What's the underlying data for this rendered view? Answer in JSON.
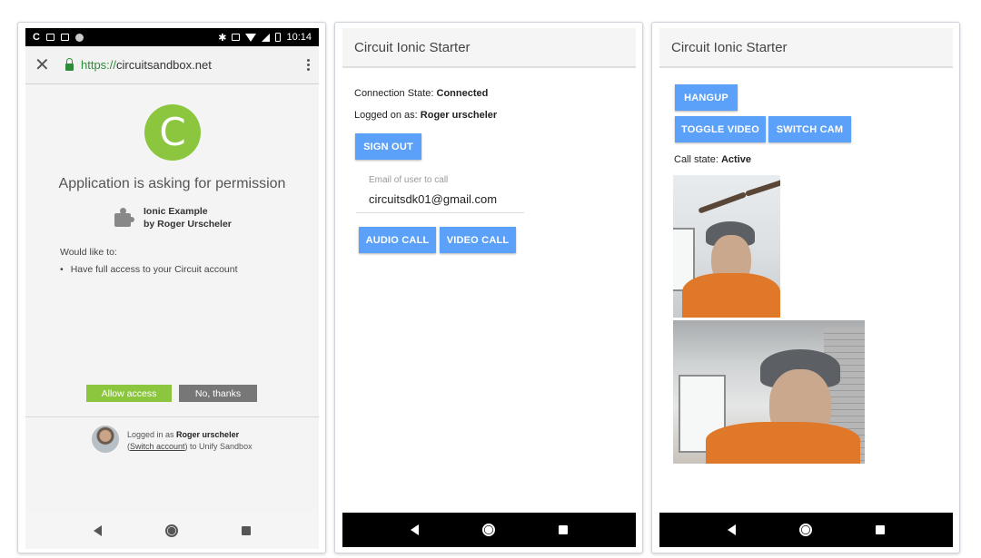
{
  "screen1": {
    "status": {
      "left_glyph": "C",
      "time": "10:14"
    },
    "browser": {
      "close": "✕",
      "url_scheme": "https://",
      "url_host": "circuitsandbox.net"
    },
    "permission": {
      "badge_letter": "C",
      "title": "Application is asking for permission",
      "app_name": "Ionic Example",
      "app_author": "by Roger Urscheler",
      "would_like": "Would like to:",
      "bullet": "Have full access to your Circuit account",
      "allow": "Allow access",
      "deny": "No, thanks",
      "logged_in_prefix": "Logged in as ",
      "logged_in_user": "Roger urscheler",
      "switch_link": "Switch account",
      "switch_suffix": ") to Unify Sandbox",
      "switch_prefix": "("
    },
    "nav": {
      "back": "back-icon",
      "home": "home-icon",
      "recents": "recents-icon"
    }
  },
  "screen2": {
    "header_title": "Circuit Ionic Starter",
    "connection_label": "Connection State: ",
    "connection_value": "Connected",
    "logged_label": "Logged on as: ",
    "logged_value": "Roger urscheler",
    "sign_out": "SIGN OUT",
    "email_label": "Email of user to call",
    "email_value": "circuitsdk01@gmail.com",
    "audio_call": "AUDIO CALL",
    "video_call": "VIDEO CALL"
  },
  "screen3": {
    "header_title": "Circuit Ionic Starter",
    "hangup": "HANGUP",
    "toggle_video": "TOGGLE VIDEO",
    "switch_cam": "SWITCH CAM",
    "call_state_label": "Call state: ",
    "call_state_value": "Active"
  },
  "colors": {
    "accent_green": "#8cc63f",
    "button_blue": "#5ba0f9",
    "deny_gray": "#777777"
  }
}
